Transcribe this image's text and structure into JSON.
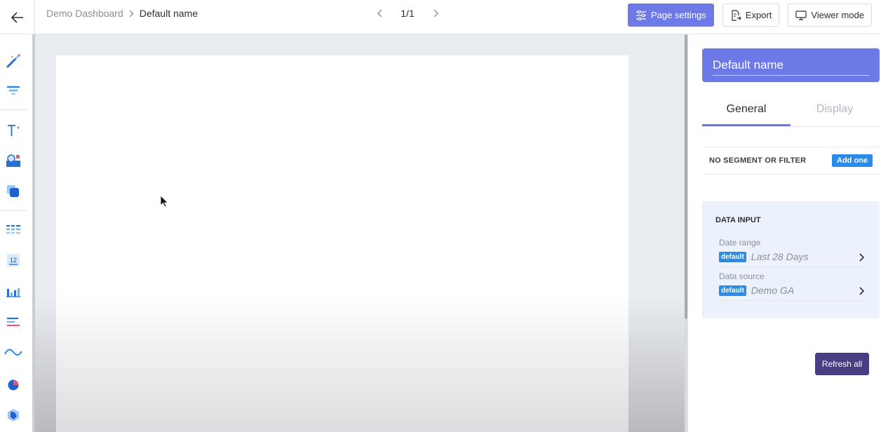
{
  "breadcrumb": {
    "parent": "Demo Dashboard",
    "current": "Default name"
  },
  "pager": {
    "text": "1/1"
  },
  "toolbar": {
    "page_settings_label": "Page settings",
    "export_label": "Export",
    "viewer_mode_label": "Viewer mode"
  },
  "left_tools": [
    "magic-wand-icon",
    "filter-icon",
    "text-icon",
    "image-icon",
    "shape-icon",
    "table-icon",
    "number-icon",
    "bar-chart-icon",
    "horizontal-bar-icon",
    "line-chart-icon",
    "pie-chart-icon",
    "geo-map-icon"
  ],
  "panel": {
    "page_name": "Default name",
    "tabs": {
      "general": "General",
      "display": "Display"
    },
    "segment": {
      "label": "NO SEGMENT OR FILTER",
      "add_label": "Add one"
    },
    "data_input": {
      "title": "DATA INPUT",
      "date_range": {
        "label": "Date range",
        "badge": "default",
        "value": "Last 28 Days"
      },
      "data_source": {
        "label": "Data source",
        "badge": "default",
        "value": "Demo GA"
      }
    },
    "refresh_label": "Refresh all"
  },
  "colors": {
    "accent": "#6e79e8",
    "blue_badge": "#2a8be8",
    "refresh": "#4a3d82"
  }
}
